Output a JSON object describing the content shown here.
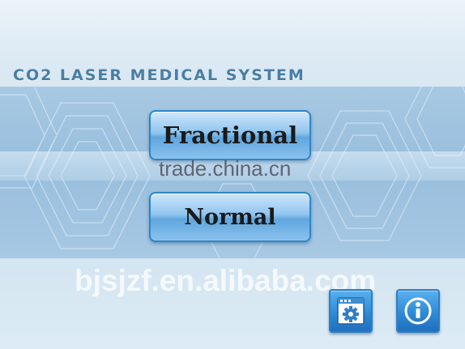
{
  "header": {
    "title": "CO2 LASER MEDICAL SYSTEM"
  },
  "modes": [
    {
      "label": "Fractional"
    },
    {
      "label": "Normal"
    }
  ],
  "toolbar": {
    "settings_icon": "settings-window-gear-icon",
    "info_icon": "info-icon"
  },
  "watermarks": [
    "trade.china.cn",
    "bjsjzf.en.alibaba.com"
  ],
  "colors": {
    "accent": "#2f86c8",
    "title": "#4a7ea3",
    "band": "#a8c9e2"
  }
}
